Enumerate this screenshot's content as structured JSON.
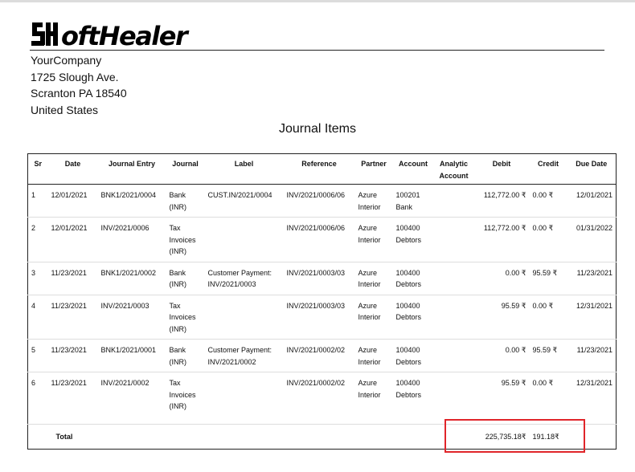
{
  "company": {
    "logo_text": "SoftHealer",
    "name": "YourCompany",
    "street": "1725 Slough Ave.",
    "city_line": "Scranton PA 18540",
    "country": "United States"
  },
  "report": {
    "title": "Journal Items",
    "columns": [
      "Sr",
      "Date",
      "Journal Entry",
      "Journal",
      "Label",
      "Reference",
      "Partner",
      "Account",
      "Analytic Account",
      "Debit",
      "Credit",
      "Due Date"
    ],
    "rows": [
      {
        "sr": "1",
        "date": "12/01/2021",
        "entry": "BNK1/2021/0004",
        "journal": "Bank (INR)",
        "label": "CUST.IN/2021/0004",
        "reference": "INV/2021/0006/06",
        "partner": "Azure Interior",
        "account": "100201 Bank",
        "analytic": "",
        "debit": "112,772.00 ₹",
        "credit": "0.00 ₹",
        "due": "12/01/2021"
      },
      {
        "sr": "2",
        "date": "12/01/2021",
        "entry": "INV/2021/0006",
        "journal": "Tax Invoices (INR)",
        "label": "",
        "reference": "INV/2021/0006/06",
        "partner": "Azure Interior",
        "account": "100400 Debtors",
        "analytic": "",
        "debit": "112,772.00 ₹",
        "credit": "0.00 ₹",
        "due": "01/31/2022"
      },
      {
        "sr": "3",
        "date": "11/23/2021",
        "entry": "BNK1/2021/0002",
        "journal": "Bank (INR)",
        "label": "Customer Payment: INV/2021/0003",
        "reference": "INV/2021/0003/03",
        "partner": "Azure Interior",
        "account": "100400 Debtors",
        "analytic": "",
        "debit": "0.00 ₹",
        "credit": "95.59 ₹",
        "due": "11/23/2021"
      },
      {
        "sr": "4",
        "date": "11/23/2021",
        "entry": "INV/2021/0003",
        "journal": "Tax Invoices (INR)",
        "label": "",
        "reference": "INV/2021/0003/03",
        "partner": "Azure Interior",
        "account": "100400 Debtors",
        "analytic": "",
        "debit": "95.59 ₹",
        "credit": "0.00 ₹",
        "due": "12/31/2021"
      },
      {
        "sr": "5",
        "date": "11/23/2021",
        "entry": "BNK1/2021/0001",
        "journal": "Bank (INR)",
        "label": "Customer Payment: INV/2021/0002",
        "reference": "INV/2021/0002/02",
        "partner": "Azure Interior",
        "account": "100400 Debtors",
        "analytic": "",
        "debit": "0.00 ₹",
        "credit": "95.59 ₹",
        "due": "11/23/2021"
      },
      {
        "sr": "6",
        "date": "11/23/2021",
        "entry": "INV/2021/0002",
        "journal": "Tax Invoices (INR)",
        "label": "",
        "reference": "INV/2021/0002/02",
        "partner": "Azure Interior",
        "account": "100400 Debtors",
        "analytic": "",
        "debit": "95.59 ₹",
        "credit": "0.00 ₹",
        "due": "12/31/2021"
      }
    ],
    "total": {
      "label": "Total",
      "debit": "225,735.18₹",
      "credit": "191.18₹"
    }
  },
  "colors": {
    "highlight": "#e0252a",
    "rule": "#222222"
  }
}
